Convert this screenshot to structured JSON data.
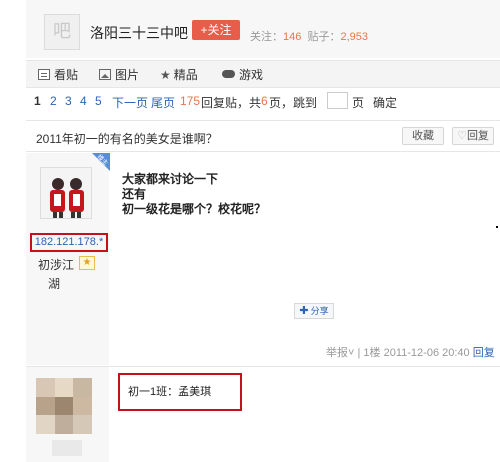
{
  "header": {
    "logo_text": "吧",
    "forum_name": "洛阳三十三中吧",
    "follow_label": "+关注",
    "follow_count_label": "关注：",
    "follow_count": "146",
    "post_count_label": "贴子：",
    "post_count": "2,953"
  },
  "tabs": [
    {
      "label": "看贴",
      "icon": "doc-icon"
    },
    {
      "label": "图片",
      "icon": "image-icon"
    },
    {
      "label": "精品",
      "icon": "star-icon"
    },
    {
      "label": "游戏",
      "icon": "gamepad-icon"
    }
  ],
  "pager": {
    "pages": [
      "1",
      "2",
      "3",
      "4",
      "5"
    ],
    "next": "下一页",
    "last": "尾页",
    "reply_count": "175",
    "reply_text": "回复贴，共",
    "page_total": "6",
    "page_text": "页，跳到",
    "page_unit": "页",
    "confirm": "确定"
  },
  "thread": {
    "title": "2011年初一的有名的美女是谁啊？",
    "collect_label": "收藏",
    "reply_label": "回复"
  },
  "post1": {
    "badge": "楼主",
    "ip": "182.121.178.*",
    "user_line1": "初涉江",
    "user_line2": "湖",
    "lines": [
      "大家都来讨论一下",
      "还有",
      "初一级花是哪个？校花呢？"
    ],
    "share_label": "分享",
    "report_label": "举报",
    "floor": "1楼",
    "time": "2011-12-06 20:40",
    "reply_label": "回复"
  },
  "post2": {
    "text": "初一1班：孟美琪"
  },
  "colors": {
    "accent_blue": "#2d64b3",
    "follow_red": "#e85c4a",
    "highlight_red": "#c4121a",
    "count_orange": "#e4774f"
  }
}
